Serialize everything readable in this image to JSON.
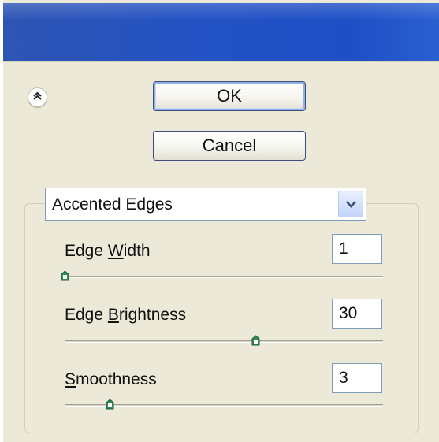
{
  "dialog": {
    "ok_label": "OK",
    "cancel_label": "Cancel",
    "collapse_icon": "double-chevron-up-icon"
  },
  "filter": {
    "selected": "Accented Edges",
    "dropdown_icon": "chevron-down-icon"
  },
  "controls": [
    {
      "label_before": "Edge ",
      "mnemonic": "W",
      "label_after": "idth",
      "value": "1",
      "min": 1,
      "max": 14
    },
    {
      "label_before": "Edge ",
      "mnemonic": "B",
      "label_after": "rightness",
      "value": "30",
      "min": 0,
      "max": 50
    },
    {
      "label_before": "",
      "mnemonic": "S",
      "label_after": "moothness",
      "value": "3",
      "min": 1,
      "max": 15
    }
  ],
  "colors": {
    "title_bar": "#2352c4",
    "dialog_bg": "#ece9d8",
    "slider_thumb": "#2e8b57"
  }
}
